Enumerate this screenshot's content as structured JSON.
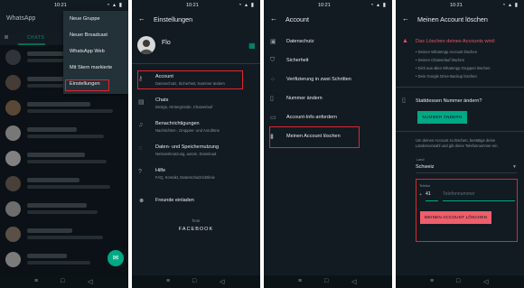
{
  "status": {
    "time": "10:21"
  },
  "phone1": {
    "app_title": "WhatsApp",
    "tab_chats": "CHATS",
    "menu": [
      "Neue Gruppe",
      "Neuer Broadcast",
      "WhatsApp Web",
      "Mit Stern markierte",
      "Einstellungen"
    ]
  },
  "phone2": {
    "title": "Einstellungen",
    "profile_name": "Flo",
    "items": [
      {
        "title": "Account",
        "sub": "Datenschutz, Sicherheit, Nummer ändern"
      },
      {
        "title": "Chats",
        "sub": "Design, Hintergründe, Chatverlauf"
      },
      {
        "title": "Benachrichtigungen",
        "sub": "Nachrichten-, Gruppen- und Anruftöne"
      },
      {
        "title": "Daten- und Speichernutzung",
        "sub": "Netzwerknutzung, autom. Download"
      },
      {
        "title": "Hilfe",
        "sub": "FAQ, Kontakt, Datenschutzrichtlinie"
      },
      {
        "title": "Freunde einladen",
        "sub": ""
      }
    ],
    "from": "from",
    "brand": "FACEBOOK"
  },
  "phone3": {
    "title": "Account",
    "items": [
      "Datenschutz",
      "Sicherheit",
      "Verifizierung in zwei Schritten",
      "Nummer ändern",
      "Account-Info anfordern",
      "Meinen Account löschen"
    ]
  },
  "phone4": {
    "title": "Meinen Account löschen",
    "warning_title": "Das Löschen deines Accounts wird:",
    "bullets": [
      "• Deinen WhatsApp Account löschen",
      "• Deinen Chatverlauf löschen",
      "• Dich aus allen WhatsApp Gruppen löschen",
      "• Dein Google Drive-Backup löschen"
    ],
    "change_number_label": "Stattdessen Nummer ändern?",
    "change_number_button": "NUMMER ÄNDERN",
    "info": "Um deinen Account zu löschen, bestätige deine Ländervorwahl und gib deine Telefonnummer ein.",
    "country_label": "Land",
    "country": "Schweiz",
    "phone_label": "Telefon",
    "plus": "+",
    "country_code": "41",
    "phone_placeholder": "Telefonnummer",
    "delete_button": "MEINEN ACCOUNT LÖSCHEN"
  },
  "colors": {
    "accent": "#00a884",
    "background": "#121b22",
    "highlight": "#e0252f",
    "danger": "#ef5e6b"
  }
}
